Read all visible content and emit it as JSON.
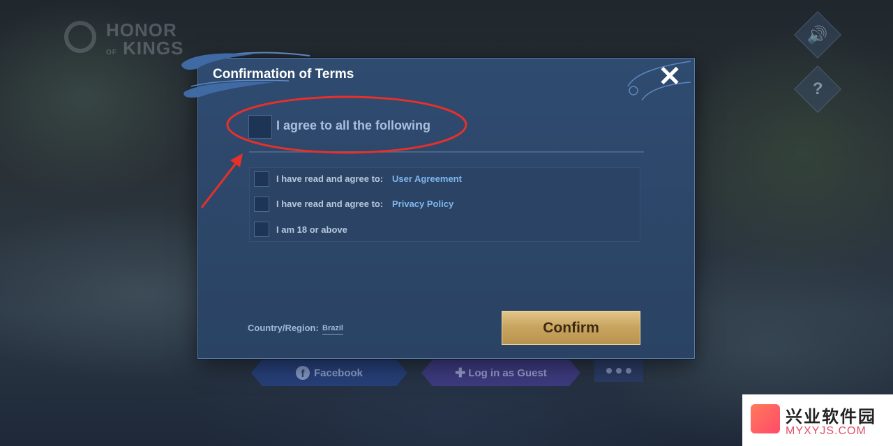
{
  "background": {
    "logo_text": "HONOR OF KINGS",
    "sound_icon": "speaker-icon",
    "help_icon": "question-icon"
  },
  "login": {
    "facebook_label": "Facebook",
    "guest_label": "Log in as Guest",
    "more_label": "more"
  },
  "dialog": {
    "title": "Confirmation of Terms",
    "close_icon": "close-icon",
    "agree_all_label": "I agree to all the following",
    "terms": [
      {
        "prefix": "I have read and agree to:",
        "link": "User Agreement"
      },
      {
        "prefix": "I have read and agree to:",
        "link": "Privacy Policy"
      },
      {
        "prefix": "I am 18 or above",
        "link": ""
      }
    ],
    "region_label": "Country/Region:",
    "region_value": "Brazil",
    "confirm_label": "Confirm"
  },
  "watermark": {
    "cn": "兴业软件园",
    "en": "MYXYJS.COM"
  },
  "colors": {
    "dialog_bg": "#2f4b70",
    "link": "#7fb6ee",
    "confirm_gold": "#c9a560",
    "annotation_red": "#e8302a"
  }
}
